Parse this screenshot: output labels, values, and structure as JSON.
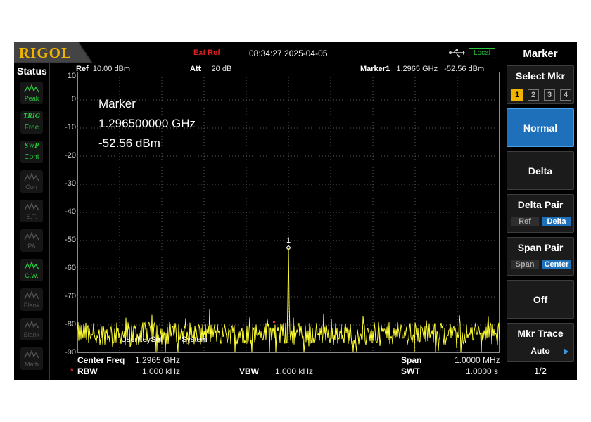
{
  "header": {
    "logo": "RIGOL",
    "ext_ref": "Ext Ref",
    "datetime": "08:34:27 2025-04-05",
    "local": "Local"
  },
  "status": {
    "title": "Status",
    "items": [
      {
        "label": "Peak",
        "active": true,
        "icon": "peak-icon"
      },
      {
        "top": "TRIG",
        "label": "Free",
        "active": true,
        "icon": "trigger-icon"
      },
      {
        "top": "SWP",
        "label": "Cont",
        "active": true,
        "icon": "sweep-icon"
      },
      {
        "label": "Corr",
        "active": false,
        "icon": "correction-icon"
      },
      {
        "label": "S.T.",
        "active": false,
        "icon": "signal-track-icon"
      },
      {
        "label": "PA",
        "active": false,
        "icon": "preamp-icon"
      },
      {
        "label": "C.W.",
        "active": true,
        "icon": "cw-icon"
      },
      {
        "label": "Blank",
        "active": false,
        "icon": "blank-icon"
      },
      {
        "label": "Blank",
        "active": false,
        "icon": "blank-icon"
      },
      {
        "label": "Math",
        "active": false,
        "icon": "math-icon"
      }
    ]
  },
  "graph_header": {
    "ref_label": "Ref",
    "ref_value": "10.00 dBm",
    "att_label": "Att",
    "att_value": "20 dB",
    "marker_label": "Marker1",
    "marker_freq": "1.2965 GHz",
    "marker_ampl": "-52.56 dBm"
  },
  "marker_readout": {
    "title": "Marker",
    "freq": "1.296500000 GHz",
    "ampl": "-52.56 dBm"
  },
  "y_axis": [
    "10",
    "0",
    "-10",
    "-20",
    "-30",
    "-40",
    "-50",
    "-60",
    "-70",
    "-80",
    "-90"
  ],
  "overlay_text": {
    "userkey": "UserKeySet",
    "system": "System"
  },
  "trace": {
    "color": "#ffff33",
    "marker_label": "1",
    "peak_freq_ghz": 1.2965,
    "peak_dbm": -52.56,
    "noise_floor_dbm": -83,
    "ref_dbm": 10,
    "db_per_div": 10,
    "span_mhz": 1.0
  },
  "bottom": {
    "center_label": "Center Freq",
    "center_value": "1.2965 GHz",
    "span_label": "Span",
    "span_value": "1.0000 MHz",
    "rbw_star": "*",
    "rbw_label": "RBW",
    "rbw_value": "1.000 kHz",
    "vbw_label": "VBW",
    "vbw_value": "1.000 kHz",
    "swt_label": "SWT",
    "swt_value": "1.0000 s"
  },
  "menu": {
    "title": "Marker",
    "select_mkr": {
      "label": "Select Mkr",
      "numbers": [
        "1",
        "2",
        "3",
        "4"
      ],
      "selected": "1"
    },
    "normal": "Normal",
    "delta": "Delta",
    "delta_pair": {
      "label": "Delta Pair",
      "ref": "Ref",
      "delta": "Delta"
    },
    "span_pair": {
      "label": "Span Pair",
      "span": "Span",
      "center": "Center"
    },
    "off": "Off",
    "mkr_trace": {
      "label": "Mkr Trace",
      "value": "Auto"
    },
    "page": "1/2"
  }
}
